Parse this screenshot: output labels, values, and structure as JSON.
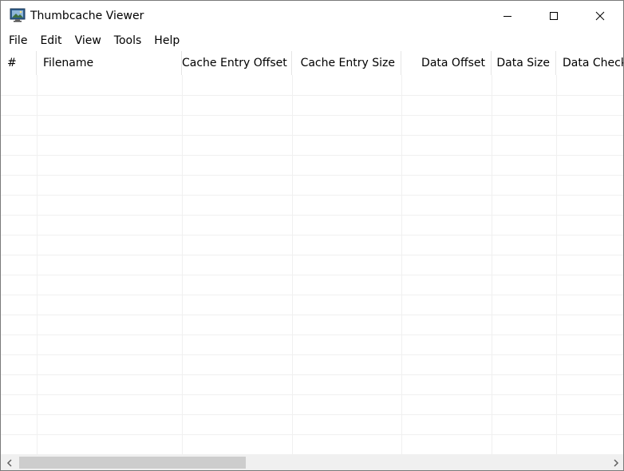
{
  "window": {
    "title": "Thumbcache Viewer",
    "icon": "thumbcache-app-icon"
  },
  "caption_buttons": {
    "minimize": "minimize-icon",
    "maximize": "maximize-icon",
    "close": "close-icon"
  },
  "menu": {
    "items": [
      {
        "label": "File"
      },
      {
        "label": "Edit"
      },
      {
        "label": "View"
      },
      {
        "label": "Tools"
      },
      {
        "label": "Help"
      }
    ]
  },
  "list": {
    "columns": [
      {
        "label": "#",
        "align": "left"
      },
      {
        "label": "Filename",
        "align": "left"
      },
      {
        "label": "Cache Entry Offset",
        "align": "right"
      },
      {
        "label": "Cache Entry Size",
        "align": "right"
      },
      {
        "label": "Data Offset",
        "align": "right"
      },
      {
        "label": "Data Size",
        "align": "right"
      },
      {
        "label": "Data Checksum",
        "align": "left"
      }
    ],
    "rows": []
  },
  "scrollbar": {
    "left_arrow": "chevron-left-icon",
    "right_arrow": "chevron-right-icon"
  },
  "colors": {
    "grid": "#f0f0f0",
    "header_divider": "#e5e5e5",
    "scrollbar_track": "#f0f0f0",
    "scrollbar_thumb": "#cdcdcd"
  }
}
